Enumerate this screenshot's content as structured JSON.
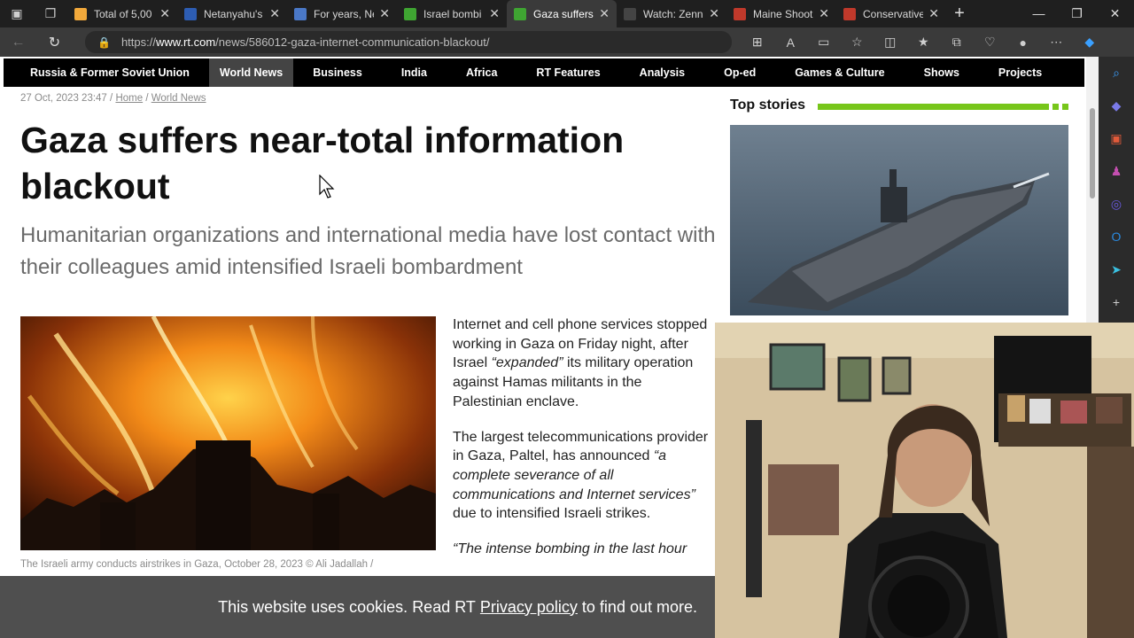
{
  "browser": {
    "tabs": [
      {
        "label": "Total of 5,00",
        "icon": "tab-favicon-check",
        "color": "#f2a93b"
      },
      {
        "label": "Netanyahu's",
        "icon": "tab-favicon-news",
        "color": "#2d5db3"
      },
      {
        "label": "For years, Ne",
        "icon": "tab-favicon-flag",
        "color": "#4a78c7"
      },
      {
        "label": "Israel bombi",
        "icon": "tab-favicon-rt",
        "color": "#3fa532"
      },
      {
        "label": "Gaza suffers",
        "icon": "tab-favicon-rt",
        "color": "#3fa532"
      },
      {
        "label": "Watch: Zenn",
        "icon": "tab-favicon-circle",
        "color": "#444"
      },
      {
        "label": "Maine Shoot",
        "icon": "tab-favicon-b",
        "color": "#c0392b"
      },
      {
        "label": "Conservative",
        "icon": "tab-favicon-b",
        "color": "#c0392b"
      }
    ],
    "active_tab": 4,
    "url_prefix": "https://",
    "url_domain": "www.rt.com",
    "url_path": "/news/586012-gaza-internet-communication-blackout/"
  },
  "site_nav": {
    "items": [
      "Russia & Former Soviet Union",
      "World News",
      "Business",
      "India",
      "Africa",
      "RT Features",
      "Analysis",
      "Op-ed",
      "Games & Culture",
      "Shows",
      "Projects"
    ],
    "active": "World News"
  },
  "article": {
    "date": "27 Oct, 2023 23:47",
    "sep": "/",
    "crumb_home": "Home",
    "crumb_section": "World News",
    "headline": "Gaza suffers near-total information blackout",
    "subheadline": "Humanitarian organizations and international media have lost contact with their colleagues amid intensified Israeli bombardment",
    "caption": "The Israeli army conducts airstrikes in Gaza, October 28, 2023 ©  Ali Jadallah /",
    "p1_a": "Internet and cell phone services stopped working in Gaza on Friday night, after Israel ",
    "p1_quote": "“expanded”",
    "p1_b": " its military operation against Hamas militants in the Palestinian enclave.",
    "p2_a": "The largest telecommunications provider in Gaza, Paltel, has announced ",
    "p2_quote": "“a complete severance of all communications and Internet services”",
    "p2_b": " due to intensified Israeli strikes.",
    "p3_quote": "“The intense bombing in the last hour"
  },
  "sidebar": {
    "top_stories": "Top stories"
  },
  "cookie_banner": {
    "text_a": "This website uses cookies. Read RT",
    "link": "Privacy policy",
    "text_b": "to find out more."
  }
}
